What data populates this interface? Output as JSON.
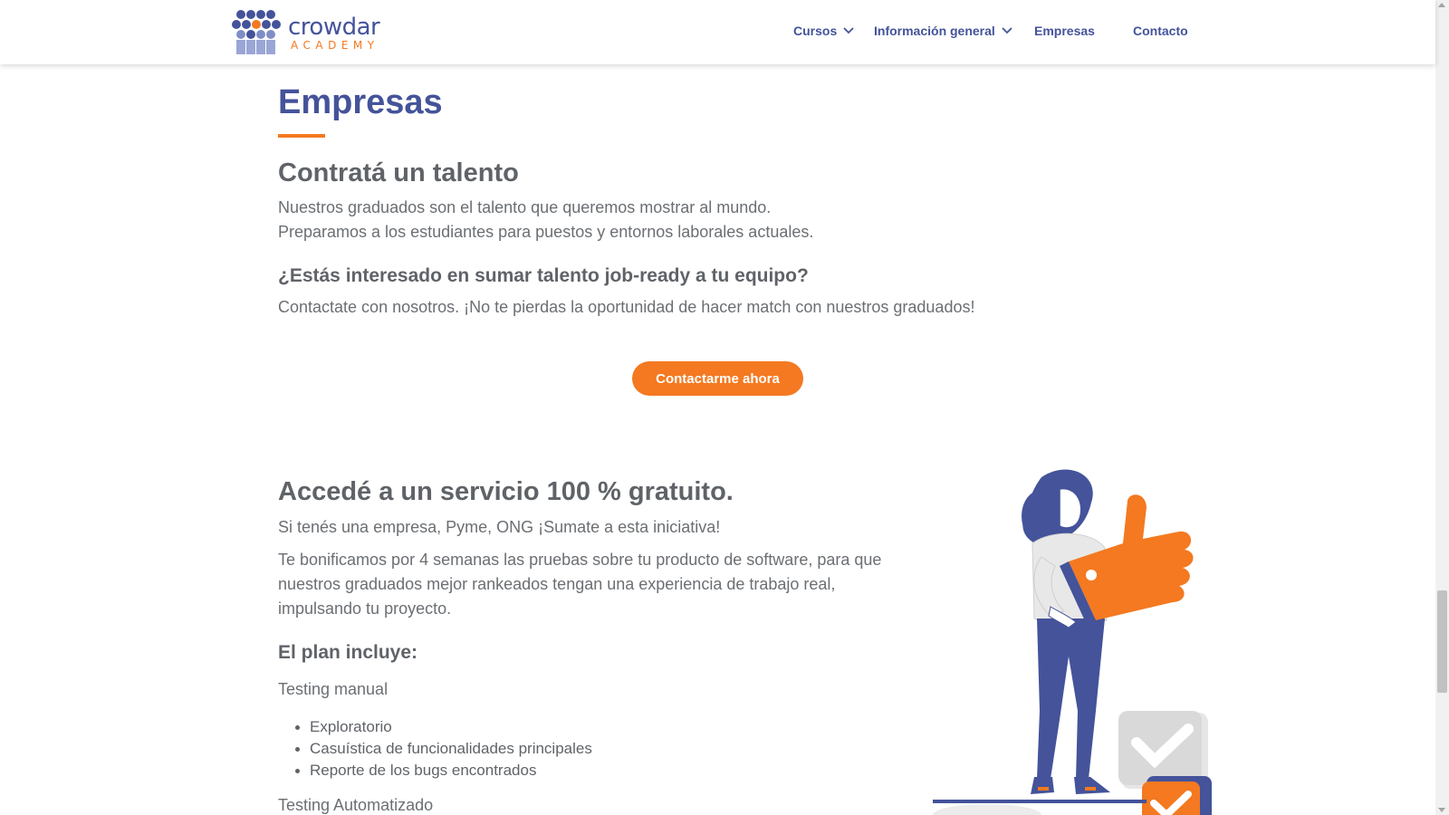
{
  "header": {
    "logo": {
      "word": "crowdar",
      "sub": "ACADEMY"
    },
    "nav": [
      {
        "label": "Cursos",
        "has_dropdown": true
      },
      {
        "label": "Información general",
        "has_dropdown": true
      },
      {
        "label": "Empresas",
        "has_dropdown": false
      },
      {
        "label": "Contacto",
        "has_dropdown": false
      }
    ]
  },
  "page": {
    "title": "Empresas",
    "section1": {
      "heading": "Contratá un talento",
      "line1": "Nuestros graduados son el talento que queremos mostrar al mundo.",
      "line2": "Preparamos a los estudiantes para puestos y entornos laborales actuales.",
      "question": "¿Estás interesado en sumar talento job-ready a tu equipo?",
      "invite": "Contactate con nosotros. ¡No te pierdas la oportunidad de hacer match con nuestros graduados!",
      "cta_label": "Contactarme ahora"
    },
    "section2": {
      "heading": "Accedé a un servicio 100 % gratuito.",
      "intro": "Si tenés una empresa, Pyme, ONG ¡Sumate a esta iniciativa!",
      "body_line1": "Te bonificamos por 4 semanas las pruebas sobre tu producto de software, para que",
      "body_line2": "nuestros graduados mejor rankeados tengan una experiencia de trabajo real,",
      "body_line3": "impulsando tu proyecto.",
      "plan_heading": "El plan incluye:",
      "manual_heading": "Testing manual",
      "manual_items": [
        "Exploratorio",
        "Casuística de funcionalidades principales",
        "Reporte de los bugs encontrados"
      ],
      "auto_heading": "Testing Automatizado"
    }
  },
  "colors": {
    "brand_blue": "#44539a",
    "brand_orange": "#f47920",
    "text_gray": "#5f6368"
  }
}
